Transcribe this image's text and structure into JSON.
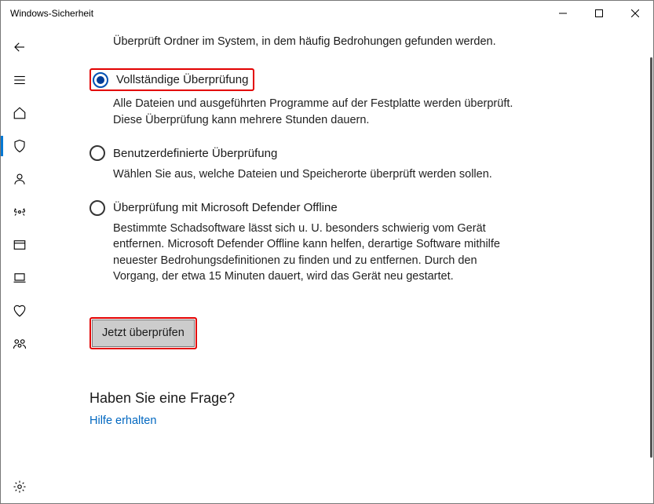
{
  "window": {
    "title": "Windows-Sicherheit"
  },
  "intro_desc": "Überprüft Ordner im System, in dem häufig Bedrohungen gefunden werden.",
  "options": {
    "full": {
      "label": "Vollständige Überprüfung",
      "desc": "Alle Dateien und ausgeführten Programme auf der Festplatte werden überprüft. Diese Überprüfung kann mehrere Stunden dauern."
    },
    "custom": {
      "label": "Benutzerdefinierte Überprüfung",
      "desc": "Wählen Sie aus, welche Dateien und Speicherorte überprüft werden sollen."
    },
    "offline": {
      "label": "Überprüfung mit Microsoft Defender Offline",
      "desc": "Bestimmte Schadsoftware lässt sich u. U. besonders schwierig vom Gerät entfernen. Microsoft Defender Offline kann helfen, derartige Software mithilfe neuester Bedrohungsdefinitionen zu finden und zu entfernen. Durch den Vorgang, der etwa 15 Minuten dauert, wird das Gerät neu gestartet."
    }
  },
  "scan_button": "Jetzt überprüfen",
  "question_heading": "Haben Sie eine Frage?",
  "help_link": "Hilfe erhalten"
}
